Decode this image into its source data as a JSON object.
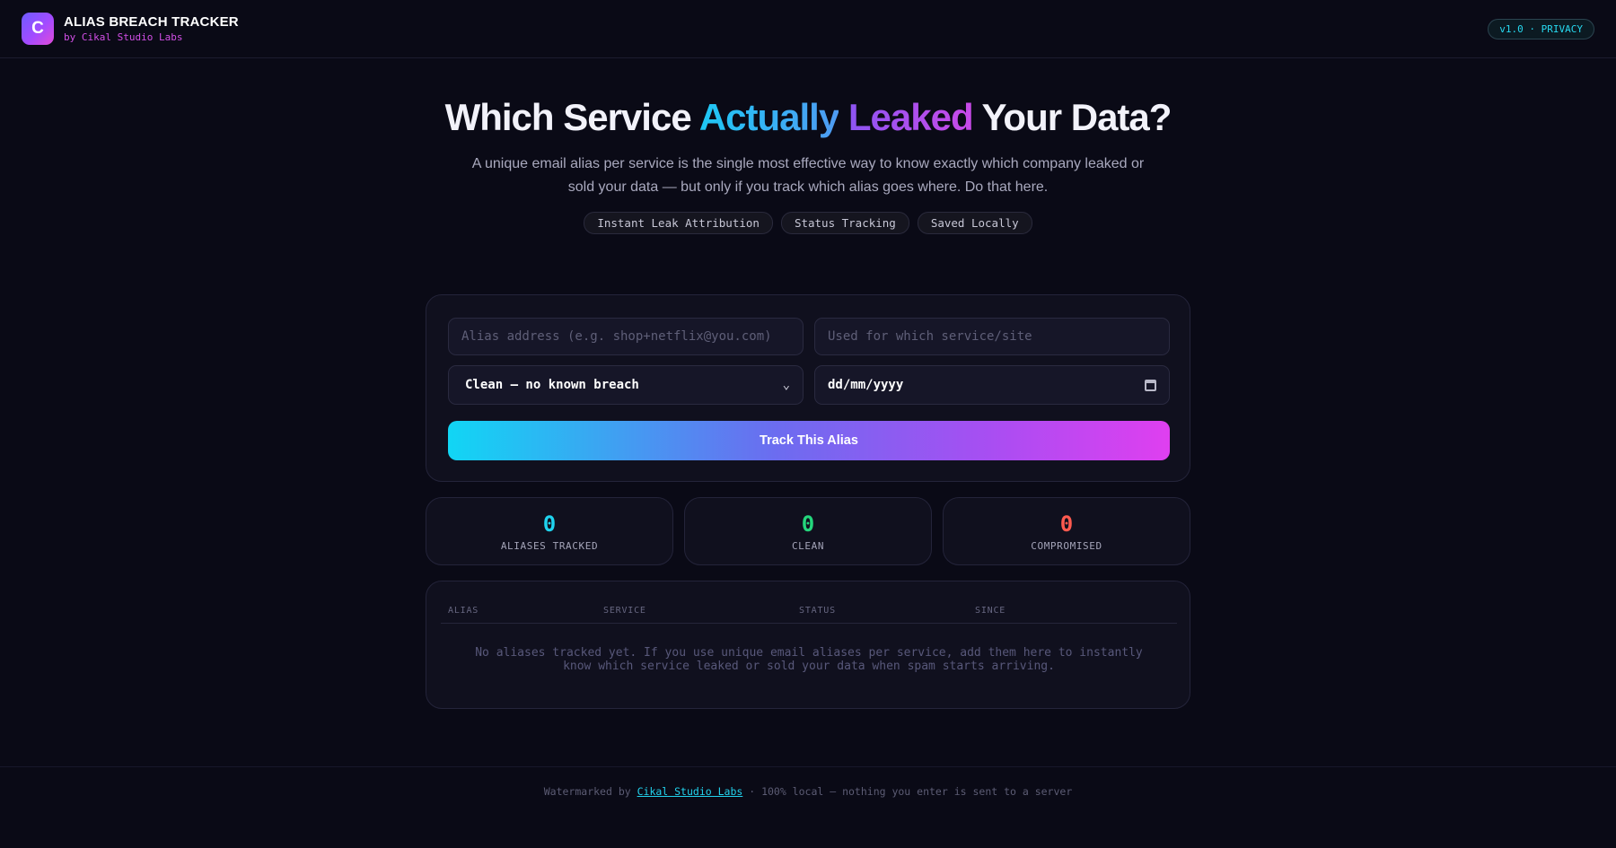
{
  "header": {
    "logo_letter": "C",
    "title": "ALIAS BREACH TRACKER",
    "subtitle": "by Cikal Studio Labs",
    "version_badge": "v1.0 · PRIVACY"
  },
  "hero": {
    "title_part1": "Which Service ",
    "title_highlight1": "Actually",
    "title_highlight2": "Leaked",
    "title_part2": " Your Data?",
    "description": "A unique email alias per service is the single most effective way to know exactly which company leaked or sold your data — but only if you track which alias goes where. Do that here.",
    "chips": [
      "Instant Leak Attribution",
      "Status Tracking",
      "Saved Locally"
    ]
  },
  "form": {
    "alias_placeholder": "Alias address (e.g. shop+netflix@you.com)",
    "service_placeholder": "Used for which service/site",
    "status_selected": "Clean — no known breach",
    "date_value": "dd/mm/yyyy",
    "submit_label": "Track This Alias"
  },
  "stats": [
    {
      "value": "0",
      "label": "ALIASES TRACKED"
    },
    {
      "value": "0",
      "label": "CLEAN"
    },
    {
      "value": "0",
      "label": "COMPROMISED"
    }
  ],
  "table": {
    "columns": [
      "ALIAS",
      "SERVICE",
      "STATUS",
      "SINCE"
    ],
    "empty_message": "No aliases tracked yet. If you use unique email aliases per service, add them here to instantly know which service leaked or sold your data when spam starts arriving."
  },
  "footer": {
    "prefix": "Watermarked by ",
    "link_label": "Cikal Studio Labs",
    "suffix": " · 100% local — nothing you enter is sent to a server"
  },
  "colors": {
    "background": "#0a0a16",
    "accent_cyan": "#1fd3ee",
    "accent_purple": "#a84ef2",
    "accent_magenta": "#df3ff0",
    "clean_green": "#24d67c",
    "compromised_red": "#ff5a4f"
  }
}
